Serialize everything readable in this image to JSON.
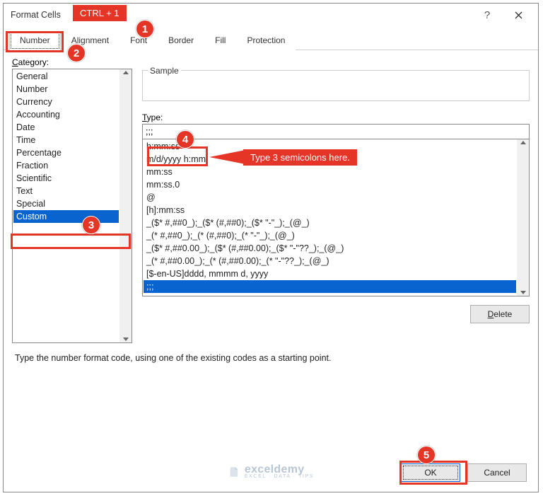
{
  "title": "Format Cells",
  "tabs": [
    "Number",
    "Alignment",
    "Font",
    "Border",
    "Fill",
    "Protection"
  ],
  "active_tab_index": 0,
  "category_label": "Category:",
  "categories": [
    "General",
    "Number",
    "Currency",
    "Accounting",
    "Date",
    "Time",
    "Percentage",
    "Fraction",
    "Scientific",
    "Text",
    "Special",
    "Custom"
  ],
  "selected_category_index": 11,
  "sample_label": "Sample",
  "type_label": "Type:",
  "type_value": ";;;",
  "type_list": [
    "h:mm:ss",
    "m/d/yyyy h:mm",
    "mm:ss",
    "mm:ss.0",
    "@",
    "[h]:mm:ss",
    "_($* #,##0_);_($* (#,##0);_($* \"-\"_);_(@_)",
    "_(* #,##0_);_(* (#,##0);_(* \"-\"_);_(@_)",
    "_($* #,##0.00_);_($* (#,##0.00);_($* \"-\"??_);_(@_)",
    "_(* #,##0.00_);_(* (#,##0.00);_(* \"-\"??_);_(@_)",
    "[$-en-US]dddd, mmmm d, yyyy",
    ";;;"
  ],
  "selected_type_index": 11,
  "delete_label": "Delete",
  "instruction": "Type the number format code, using one of the existing codes as a starting point.",
  "ok_label": "OK",
  "cancel_label": "Cancel",
  "annotations": {
    "shortcut_pill": "CTRL + 1",
    "type_callout": "Type 3 semicolons here."
  },
  "watermark": {
    "brand": "exceldemy",
    "tag": "EXCEL · DATA · TIPS"
  }
}
